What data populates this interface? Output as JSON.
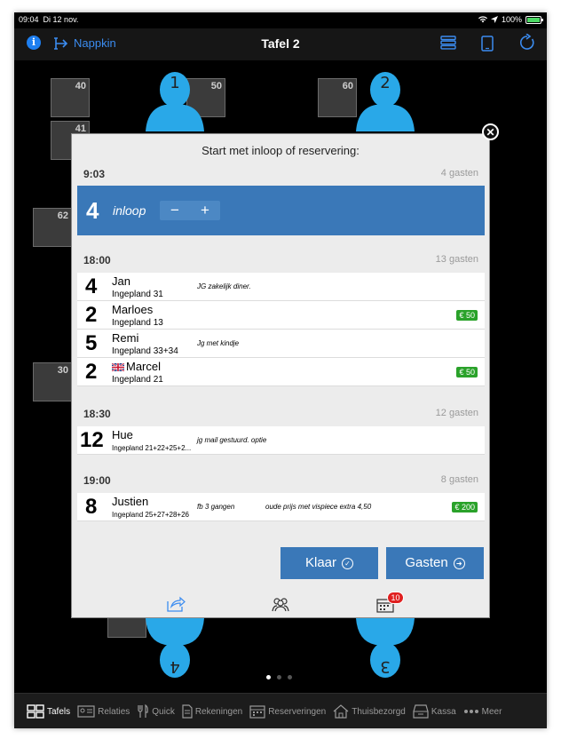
{
  "status_bar": {
    "time": "09:04",
    "date": "Di 12 nov.",
    "battery": "100%"
  },
  "navbar": {
    "back_label": "Nappkin",
    "title": "Tafel 2"
  },
  "floor": {
    "tables": [
      "40",
      "50",
      "60",
      "41",
      "62",
      "30"
    ],
    "seats": [
      "1",
      "2",
      "4",
      "3"
    ]
  },
  "modal": {
    "title": "Start met inloop of reservering:",
    "walkin_section": {
      "time": "9:03",
      "guests": "4 gasten"
    },
    "walkin": {
      "count": "4",
      "label": "inloop",
      "minus": "−",
      "plus": "+"
    },
    "sections": [
      {
        "time": "18:00",
        "guests": "13 gasten",
        "rows": [
          {
            "count": "4",
            "name": "Jan",
            "sub": "Ingepland 31",
            "note": "JG zakelijk diner."
          },
          {
            "count": "2",
            "name": "Marloes",
            "sub": "Ingepland 13",
            "badge": "€ 50"
          },
          {
            "count": "5",
            "name": "Remi",
            "sub": "Ingepland 33+34",
            "note": "Jg met kindje"
          },
          {
            "count": "2",
            "name": "Marcel",
            "sub": "Ingepland 21",
            "badge": "€ 50"
          }
        ]
      },
      {
        "time": "18:30",
        "guests": "12 gasten",
        "rows": [
          {
            "count": "12",
            "name": "Hue",
            "sub": "Ingepland 21+22+25+2...",
            "note": "jg mail gestuurd. optie"
          }
        ]
      },
      {
        "time": "19:00",
        "guests": "8 gasten",
        "rows": [
          {
            "count": "8",
            "name": "Justien",
            "sub": "Ingepland 25+27+28+26",
            "note": "fb 3 gangen",
            "note2": "oude prijs met vispiece extra 4,50",
            "badge": "€ 200"
          }
        ]
      }
    ],
    "buttons": {
      "done": "Klaar",
      "guests": "Gasten"
    },
    "calendar_badge": "10"
  },
  "pager": {
    "pages": 3,
    "current": 1
  },
  "tabbar": {
    "items": [
      "Tafels",
      "Relaties",
      "Quick",
      "Rekeningen",
      "Reserveringen",
      "Thuisbezorgd",
      "Kassa",
      "Meer"
    ],
    "active": "Tafels"
  },
  "colors": {
    "accent": "#3a78b8",
    "nav_blue": "#3b8cf0",
    "seat": "#29a8e8",
    "badge_green": "#2aa22a",
    "alert_red": "#e02020"
  }
}
